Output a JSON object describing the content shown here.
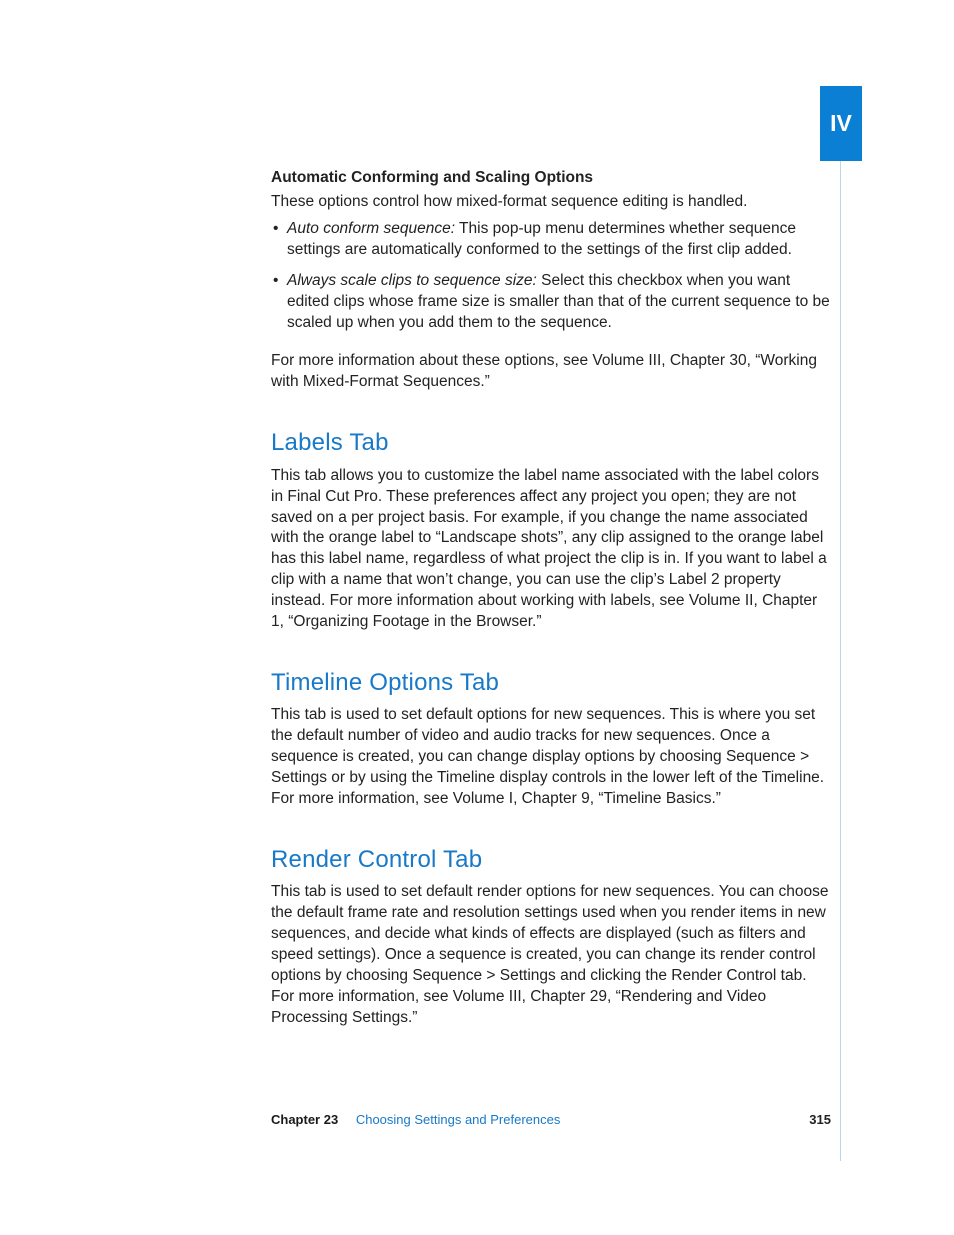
{
  "partTab": "IV",
  "s1": {
    "heading": "Automatic Conforming and Scaling Options",
    "intro": "These options control how mixed-format sequence editing is handled.",
    "b1term": "Auto conform sequence:",
    "b1text": "  This pop-up menu determines whether sequence settings are automatically conformed to the settings of the first clip added.",
    "b2term": "Always scale clips to sequence size:",
    "b2text": "  Select this checkbox when you want edited clips whose frame size is smaller than that of the current sequence to be scaled up when you add them to the sequence.",
    "outro": "For more information about these options, see Volume III, Chapter 30, “Working with Mixed-Format Sequences.”"
  },
  "s2": {
    "title": "Labels Tab",
    "body": "This tab allows you to customize the label name associated with the label colors in Final Cut Pro. These preferences affect any project you open; they are not saved on a per project basis. For example, if you change the name associated with the orange label to “Landscape shots”, any clip assigned to the orange label has this label name, regardless of what project the clip is in. If you want to label a clip with a name that won’t change, you can use the clip’s Label 2 property instead. For more information about working with labels, see Volume II, Chapter 1, “Organizing Footage in the Browser.”"
  },
  "s3": {
    "title": "Timeline Options Tab",
    "body": "This tab is used to set default options for new sequences. This is where you set the default number of video and audio tracks for new sequences. Once a sequence is created, you can change display options by choosing Sequence > Settings or by using the Timeline display controls in the lower left of the Timeline. For more information, see Volume I, Chapter 9, “Timeline Basics.”"
  },
  "s4": {
    "title": "Render Control Tab",
    "body": "This tab is used to set default render options for new sequences. You can choose the default frame rate and resolution settings used when you render items in new sequences, and decide what kinds of effects are displayed (such as filters and speed settings). Once a sequence is created, you can change its render control options by choosing Sequence > Settings and clicking the Render Control tab. For more information, see Volume III, Chapter 29, “Rendering and Video Processing Settings.”"
  },
  "footer": {
    "chapnum": "Chapter 23",
    "chaptitle": "Choosing Settings and Preferences",
    "pagenum": "315"
  }
}
